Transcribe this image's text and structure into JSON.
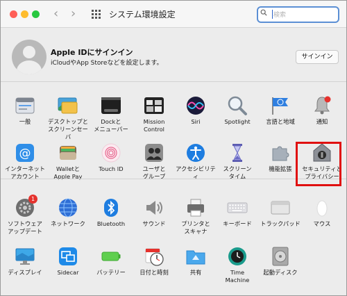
{
  "window": {
    "title": "システム環境設定"
  },
  "search": {
    "placeholder": "検索"
  },
  "apple_id": {
    "title": "Apple IDにサインイン",
    "subtitle": "iCloudやApp Storeなどを設定します。",
    "signin_label": "サインイン"
  },
  "row1": [
    {
      "label": "一般",
      "icon": "general-icon"
    },
    {
      "label": "デスクトップと\nスクリーンセーバ",
      "icon": "desktop-screensaver-icon"
    },
    {
      "label": "Dockと\nメニューバー",
      "icon": "dock-menubar-icon"
    },
    {
      "label": "Mission\nControl",
      "icon": "mission-control-icon"
    },
    {
      "label": "Siri",
      "icon": "siri-icon"
    },
    {
      "label": "Spotlight",
      "icon": "spotlight-icon"
    },
    {
      "label": "言語と地域",
      "icon": "language-region-icon"
    },
    {
      "label": "通知",
      "icon": "notifications-icon"
    }
  ],
  "row2": [
    {
      "label": "インターネット\nアカウント",
      "icon": "internet-accounts-icon"
    },
    {
      "label": "Walletと\nApple Pay",
      "icon": "wallet-icon"
    },
    {
      "label": "Touch ID",
      "icon": "touch-id-icon"
    },
    {
      "label": "ユーザと\nグループ",
      "icon": "users-groups-icon"
    },
    {
      "label": "アクセシビリティ",
      "icon": "accessibility-icon"
    },
    {
      "label": "スクリーン\nタイム",
      "icon": "screen-time-icon"
    },
    {
      "label": "機能拡張",
      "icon": "extensions-icon"
    },
    {
      "label": "セキュリティと\nプライバシー",
      "icon": "security-privacy-icon"
    }
  ],
  "row3": [
    {
      "label": "ソフトウェア\nアップデート",
      "icon": "software-update-icon",
      "badge": "1"
    },
    {
      "label": "ネットワーク",
      "icon": "network-icon"
    },
    {
      "label": "Bluetooth",
      "icon": "bluetooth-icon"
    },
    {
      "label": "サウンド",
      "icon": "sound-icon"
    },
    {
      "label": "プリンタと\nスキャナ",
      "icon": "printers-scanners-icon"
    },
    {
      "label": "キーボード",
      "icon": "keyboard-icon"
    },
    {
      "label": "トラックパッド",
      "icon": "trackpad-icon"
    },
    {
      "label": "マウス",
      "icon": "mouse-icon"
    }
  ],
  "row4": [
    {
      "label": "ディスプレイ",
      "icon": "displays-icon"
    },
    {
      "label": "Sidecar",
      "icon": "sidecar-icon"
    },
    {
      "label": "バッテリー",
      "icon": "battery-icon"
    },
    {
      "label": "日付と時刻",
      "icon": "date-time-icon"
    },
    {
      "label": "共有",
      "icon": "sharing-icon"
    },
    {
      "label": "Time\nMachine",
      "icon": "time-machine-icon"
    },
    {
      "label": "起動ディスク",
      "icon": "startup-disk-icon"
    }
  ],
  "colors": {
    "accent": "#3b7be0",
    "highlight": "#e01010",
    "badge": "#e5322d"
  }
}
